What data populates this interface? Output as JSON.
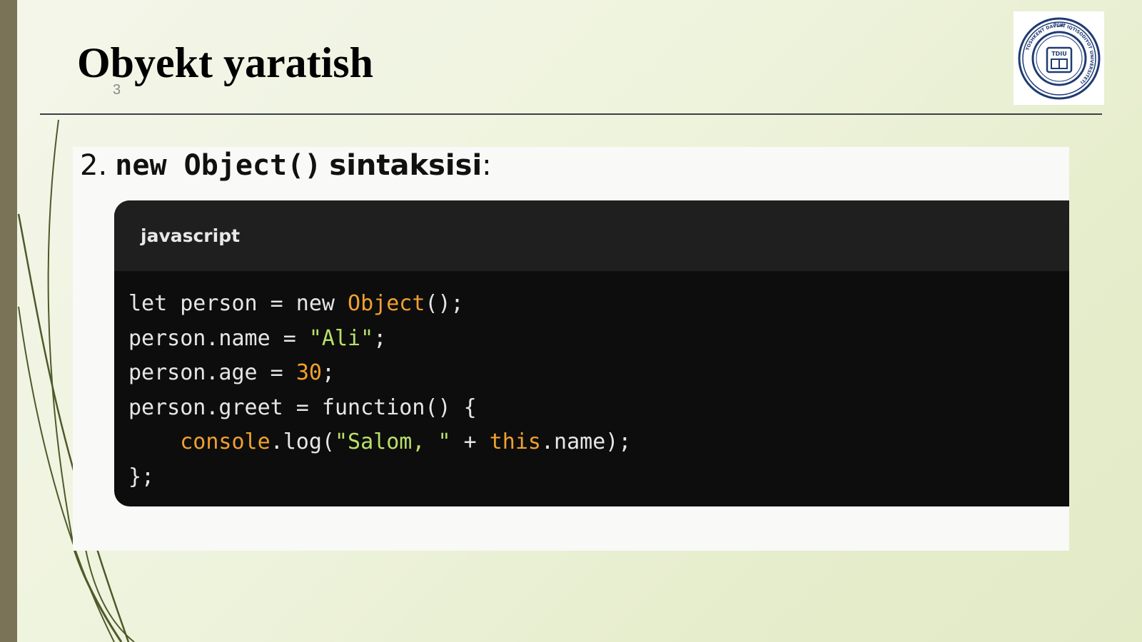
{
  "slide": {
    "title": "Obyekt yaratish",
    "number": "3"
  },
  "logo": {
    "icon": "university-seal-icon",
    "top_text": "TGIU",
    "center_text": "TDIU",
    "ring_text": "TOSHKENT DAVLAT IQTISODIYOT UNIVERSITETI"
  },
  "section": {
    "number": "2.",
    "code_part": "new Object()",
    "word_part": "sintaksisi",
    "colon": ":"
  },
  "code_block": {
    "language": "javascript",
    "lines": [
      [
        {
          "t": "let person = new ",
          "c": "kw"
        },
        {
          "t": "Object",
          "c": "class"
        },
        {
          "t": "();",
          "c": "kw"
        }
      ],
      [
        {
          "t": "person.name = ",
          "c": "kw"
        },
        {
          "t": "\"Ali\"",
          "c": "str"
        },
        {
          "t": ";",
          "c": "kw"
        }
      ],
      [
        {
          "t": "person.age = ",
          "c": "kw"
        },
        {
          "t": "30",
          "c": "num"
        },
        {
          "t": ";",
          "c": "kw"
        }
      ],
      [
        {
          "t": "person.greet = function() {",
          "c": "kw"
        }
      ],
      [
        {
          "t": "    ",
          "c": "kw"
        },
        {
          "t": "console",
          "c": "fn"
        },
        {
          "t": ".log(",
          "c": "kw"
        },
        {
          "t": "\"Salom, \"",
          "c": "str"
        },
        {
          "t": " + ",
          "c": "kw"
        },
        {
          "t": "this",
          "c": "this"
        },
        {
          "t": ".name);",
          "c": "kw"
        }
      ],
      [
        {
          "t": "};",
          "c": "kw"
        }
      ]
    ]
  },
  "colors": {
    "sidebar": "#7a7357",
    "code_background": "#0d0d0d",
    "code_header": "#1f1f1f",
    "keyword_orange": "#f0a030",
    "string_green": "#b8e068"
  }
}
